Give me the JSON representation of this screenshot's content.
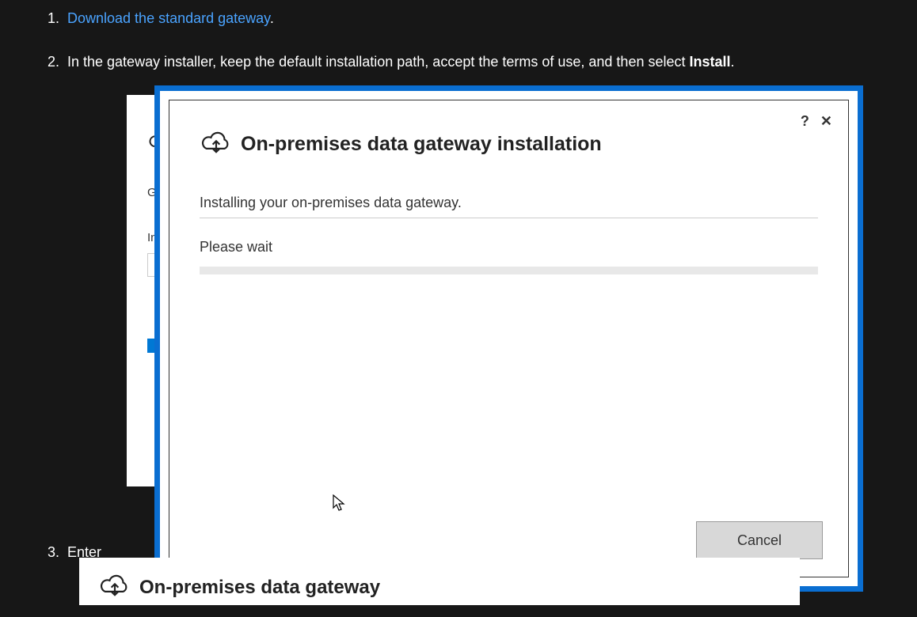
{
  "doc": {
    "step1": {
      "number": "1.",
      "link_text": "Download the standard gateway",
      "after_text": "."
    },
    "step2": {
      "number": "2.",
      "text_before": "In the gateway installer, keep the default installation path, accept the terms of use, and then select ",
      "bold_word": "Install",
      "after": "."
    },
    "step3": {
      "number": "3.",
      "text": "Enter"
    }
  },
  "bg_window": {
    "partial_text1": "Ge",
    "partial_text2": "Ins"
  },
  "dialog": {
    "title": "On-premises data gateway installation",
    "help_symbol": "?",
    "close_symbol": "✕",
    "status": "Installing your on-premises data gateway.",
    "wait": "Please wait",
    "cancel": "Cancel"
  },
  "bottom_dialog": {
    "partial_title": "On-premises data gateway"
  }
}
